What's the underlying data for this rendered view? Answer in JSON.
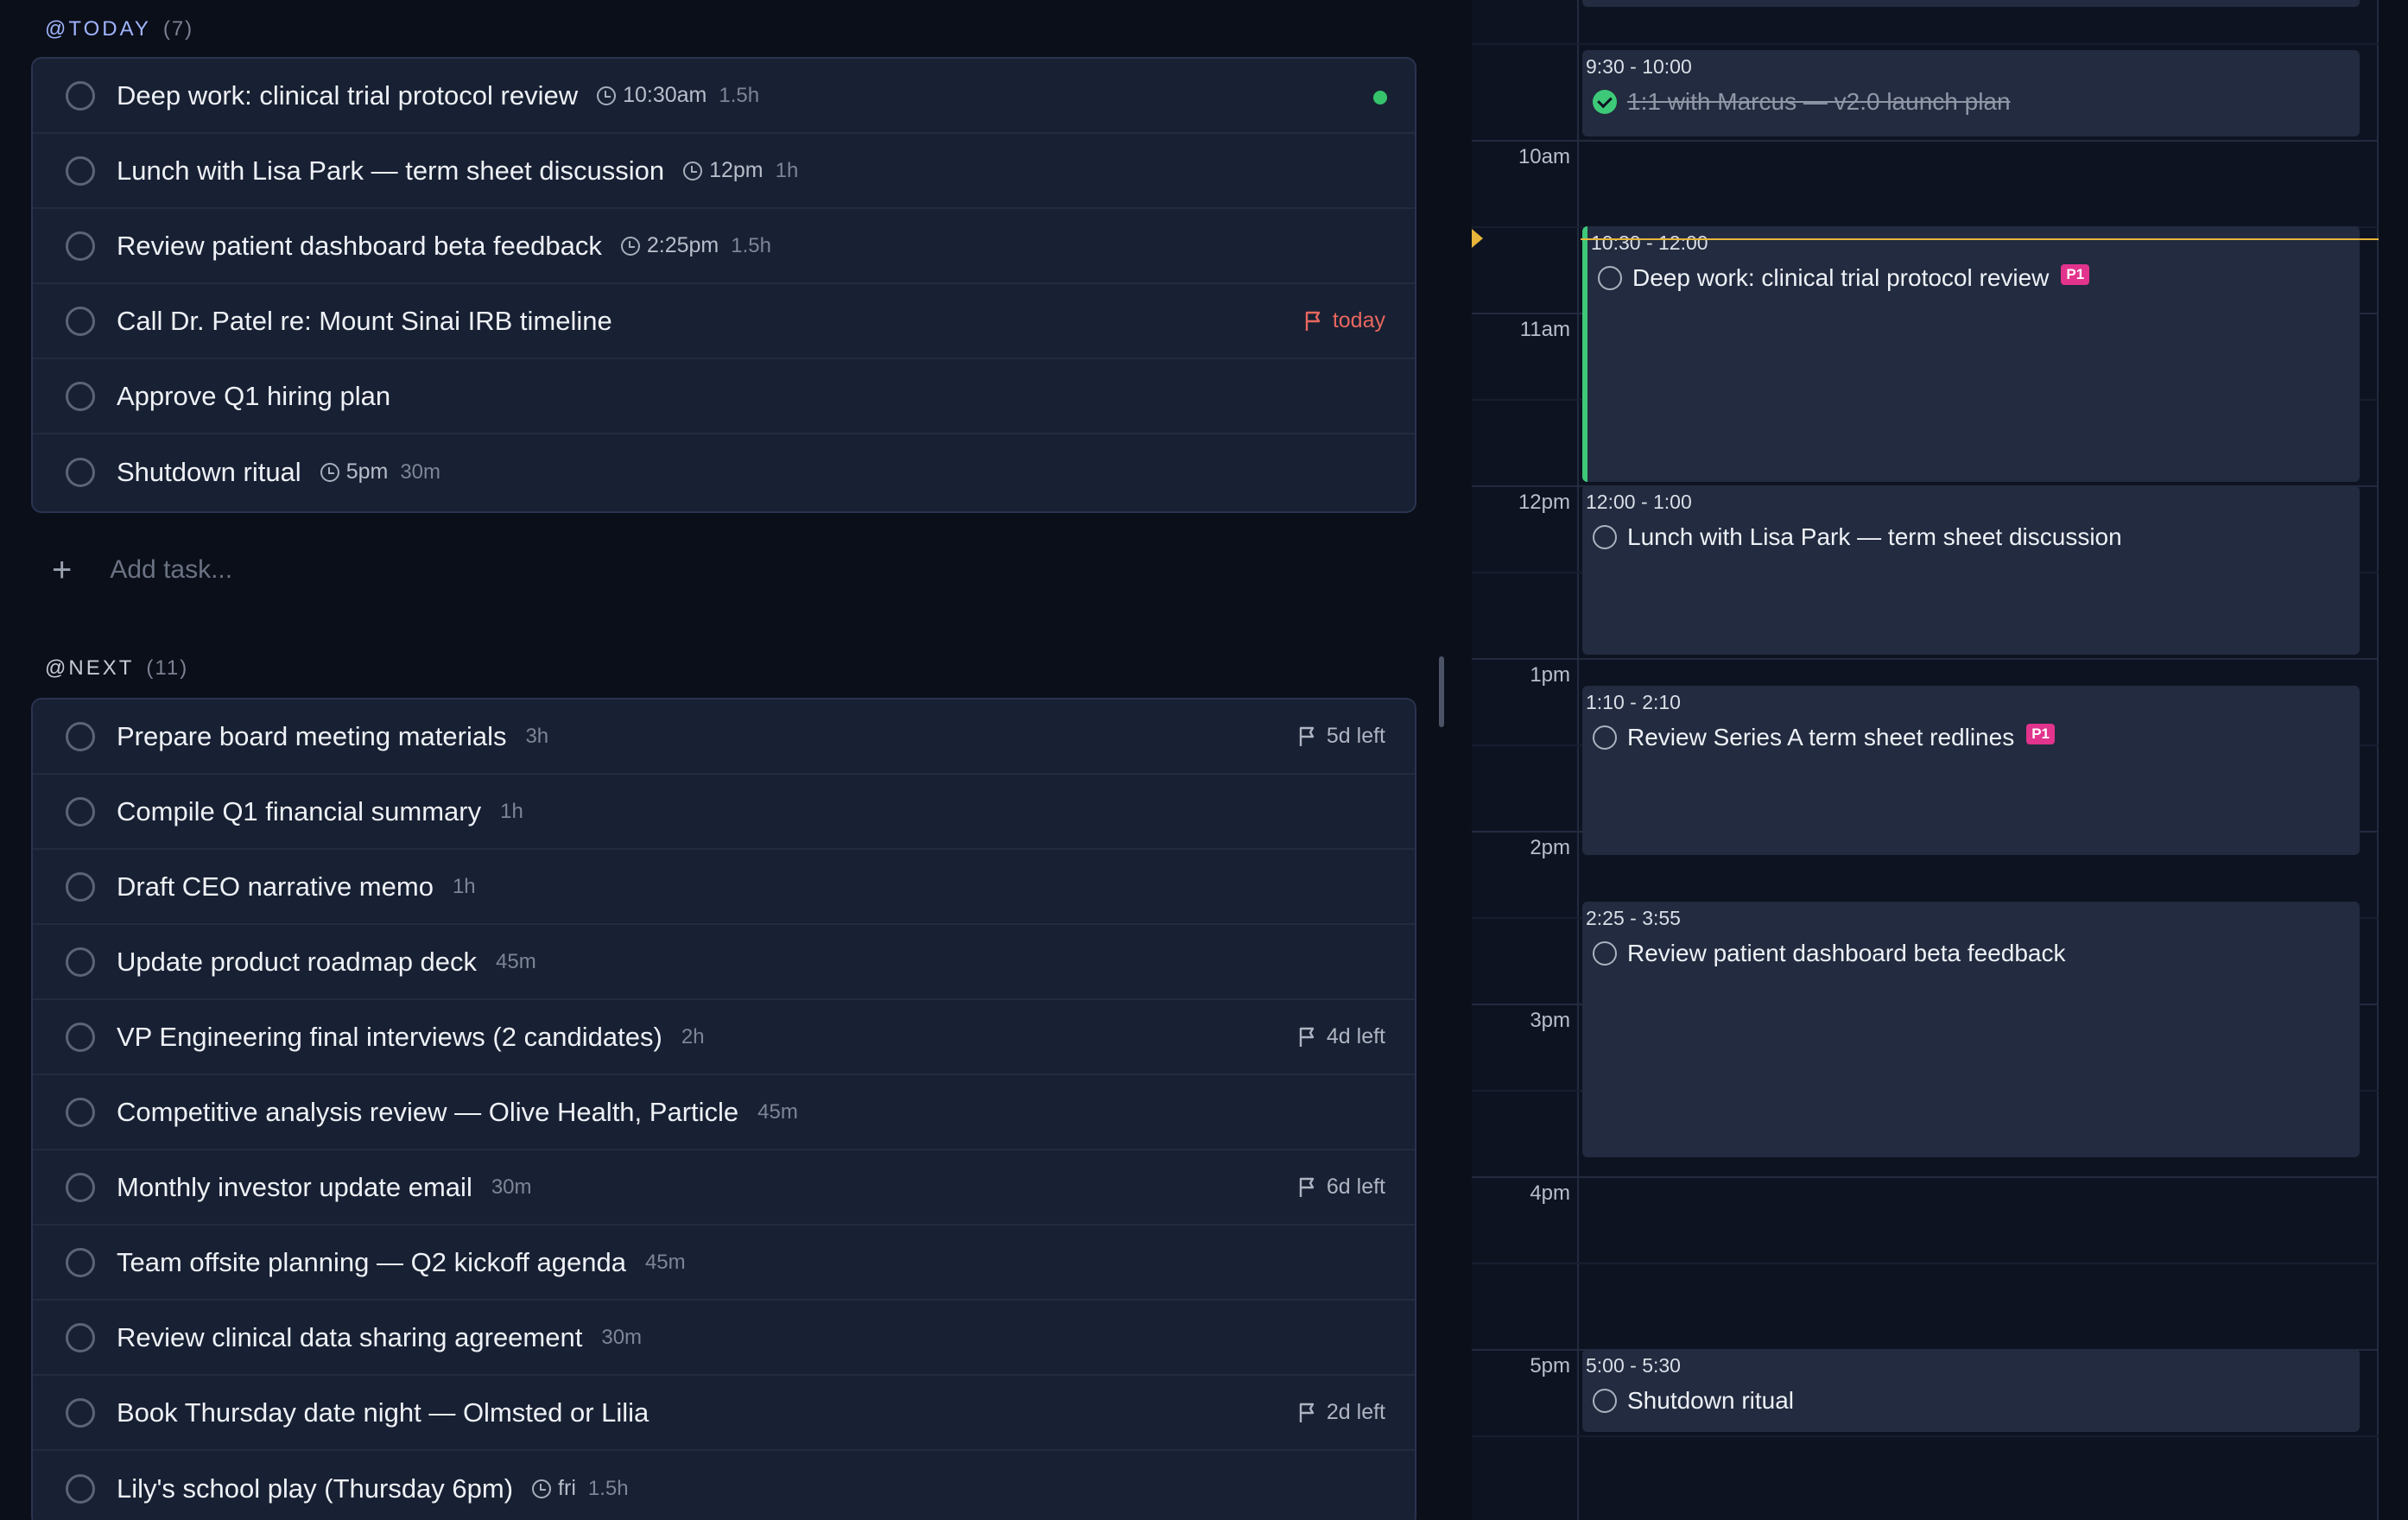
{
  "today": {
    "label": "@TODAY",
    "count": "(7)",
    "tasks": [
      {
        "title": "Deep work: clinical trial protocol review",
        "time": "10:30am",
        "duration": "1.5h"
      },
      {
        "title": "Lunch with Lisa Park — term sheet discussion",
        "time": "12pm",
        "duration": "1h"
      },
      {
        "title": "Review patient dashboard beta feedback",
        "time": "2:25pm",
        "duration": "1.5h"
      },
      {
        "title": "Call Dr. Patel re: Mount Sinai IRB timeline",
        "flag": "today"
      },
      {
        "title": "Approve Q1 hiring plan"
      },
      {
        "title": "Shutdown ritual",
        "time": "5pm",
        "duration": "30m"
      }
    ],
    "add_placeholder": "Add task...",
    "add_symbol": "+"
  },
  "next": {
    "label": "@NEXT",
    "count": "(11)",
    "tasks": [
      {
        "title": "Prepare board meeting materials",
        "duration": "3h",
        "flag": "5d left"
      },
      {
        "title": "Compile Q1 financial summary",
        "duration": "1h"
      },
      {
        "title": "Draft CEO narrative memo",
        "duration": "1h"
      },
      {
        "title": "Update product roadmap deck",
        "duration": "45m"
      },
      {
        "title": "VP Engineering final interviews (2 candidates)",
        "duration": "2h",
        "flag": "4d left"
      },
      {
        "title": "Competitive analysis review — Olive Health, Particle",
        "duration": "45m"
      },
      {
        "title": "Monthly investor update email",
        "duration": "30m",
        "flag": "6d left"
      },
      {
        "title": "Team offsite planning — Q2 kickoff agenda",
        "duration": "45m"
      },
      {
        "title": "Review clinical data sharing agreement",
        "duration": "30m"
      },
      {
        "title": "Book Thursday date night — Olmsted or Lilia",
        "flag": "2d left"
      },
      {
        "title": "Lily's school play (Thursday 6pm)",
        "time": "fri",
        "duration": "1.5h"
      }
    ]
  },
  "calendar": {
    "hours": [
      "10am",
      "11am",
      "12pm",
      "1pm",
      "2pm",
      "3pm",
      "4pm",
      "5pm"
    ],
    "events": [
      {
        "time": "9:30 - 10:00",
        "title": "1:1 with Marcus — v2.0 launch plan",
        "done": true
      },
      {
        "time": "10:30 - 12:00",
        "title": "Deep work: clinical trial protocol review",
        "badge": "P1"
      },
      {
        "time": "12:00 - 1:00",
        "title": "Lunch with Lisa Park — term sheet discussion"
      },
      {
        "time": "1:10 - 2:10",
        "title": "Review Series A term sheet redlines",
        "badge": "P1"
      },
      {
        "time": "2:25 - 3:55",
        "title": "Review patient dashboard beta feedback"
      },
      {
        "time": "5:00 - 5:30",
        "title": "Shutdown ritual"
      }
    ]
  },
  "colors": {
    "accent_today": "#9fb4ff",
    "flag_today": "#e8675f",
    "priority_badge": "#e2338d",
    "done_green": "#3ec979",
    "now_line": "#e6b53a"
  }
}
